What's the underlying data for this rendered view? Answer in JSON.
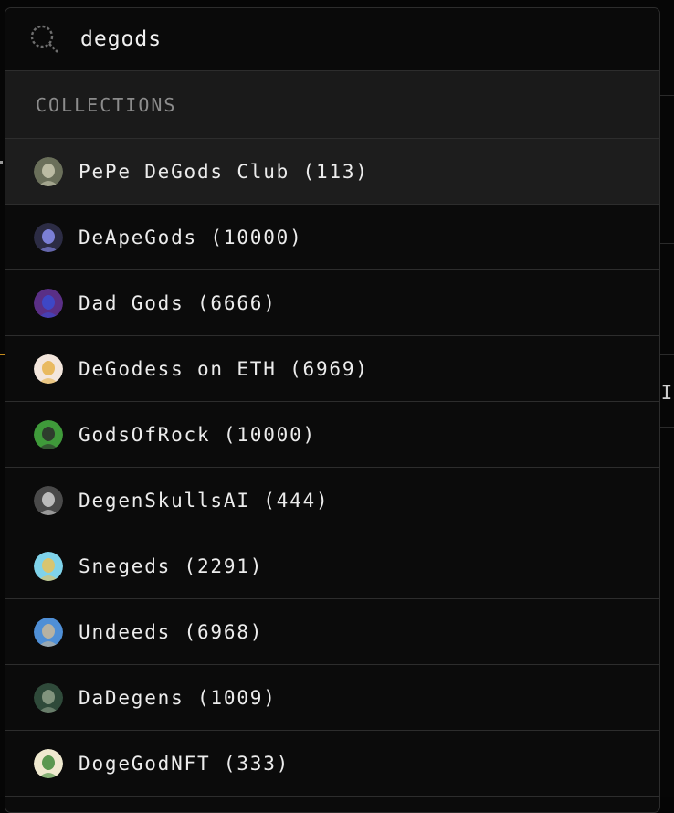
{
  "search": {
    "value": "degods",
    "placeholder": "",
    "icon": "search-icon"
  },
  "dropdown": {
    "section_title": "COLLECTIONS",
    "items": [
      {
        "label": "PePe DeGods Club (113)",
        "avatar_color": "#6a6f5a",
        "avatar_accent": "#c9c9b0",
        "highlighted": true
      },
      {
        "label": "DeApeGods (10000)",
        "avatar_color": "#2c2c44",
        "avatar_accent": "#8a8ef0",
        "highlighted": false
      },
      {
        "label": "Dad Gods (6666)",
        "avatar_color": "#5a2f86",
        "avatar_accent": "#3a4bd0",
        "highlighted": false
      },
      {
        "label": "DeGodess on ETH (6969)",
        "avatar_color": "#f3e6dc",
        "avatar_accent": "#e6b24a",
        "highlighted": false
      },
      {
        "label": "GodsOfRock (10000)",
        "avatar_color": "#3f9a3a",
        "avatar_accent": "#2b2b2b",
        "highlighted": false
      },
      {
        "label": "DegenSkullsAI (444)",
        "avatar_color": "#4a4a4a",
        "avatar_accent": "#cfcfcf",
        "highlighted": false
      },
      {
        "label": "Snegeds (2291)",
        "avatar_color": "#7fd3ea",
        "avatar_accent": "#e8c25a",
        "highlighted": false
      },
      {
        "label": "Undeeds (6968)",
        "avatar_color": "#4f8fd6",
        "avatar_accent": "#c8b89a",
        "highlighted": false
      },
      {
        "label": "DaDegens (1009)",
        "avatar_color": "#2f4a3a",
        "avatar_accent": "#8fa08a",
        "highlighted": false
      },
      {
        "label": "DogeGodNFT (333)",
        "avatar_color": "#efe9cf",
        "avatar_accent": "#3f8a3a",
        "highlighted": false
      }
    ]
  }
}
